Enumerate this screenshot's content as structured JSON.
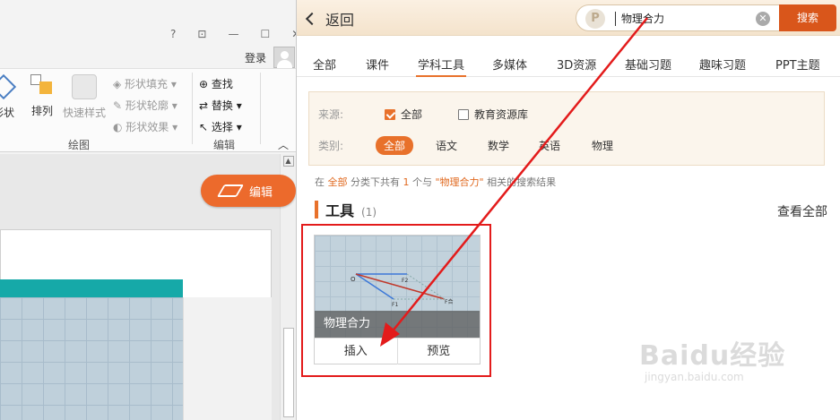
{
  "left_app": {
    "window_controls": [
      "?",
      "⊡",
      "—",
      "☐",
      "✕"
    ],
    "login": "登录",
    "ribbon": {
      "shape_label": "形状",
      "arrange_label": "排列",
      "quick_style_label": "快速样式",
      "shape_fill": "形状填充",
      "shape_outline": "形状轮廓",
      "shape_effect": "形状效果",
      "find": "查找",
      "replace": "替换",
      "select": "选择",
      "group_draw": "绘图",
      "group_edit": "编辑"
    },
    "edit_button": "编辑"
  },
  "panel": {
    "back_label": "返回",
    "search": {
      "value": "物理合力",
      "button": "搜索",
      "logo_letter": "P"
    },
    "tabs": [
      {
        "label": "全部"
      },
      {
        "label": "课件"
      },
      {
        "label": "学科工具",
        "active": true
      },
      {
        "label": "多媒体"
      },
      {
        "label": "3D资源"
      },
      {
        "label": "基础习题"
      },
      {
        "label": "趣味习题"
      },
      {
        "label": "PPT主题"
      }
    ],
    "filters": {
      "source_label": "来源:",
      "source_all": "全部",
      "source_library": "教育资源库",
      "category_label": "类别:",
      "categories": [
        "全部",
        "语文",
        "数学",
        "英语",
        "物理"
      ]
    },
    "summary": {
      "p1": "在",
      "scope": "全部",
      "p2": "分类下共有",
      "count": "1",
      "p3": "个与",
      "query": "\"物理合力\"",
      "p4": "相关的搜索结果"
    },
    "section": {
      "title": "工具",
      "count": "(1)",
      "view_all": "查看全部"
    },
    "card": {
      "name": "物理合力",
      "insert": "插入",
      "preview": "预览",
      "diagram_labels": {
        "origin": "O",
        "f1": "F1",
        "f2": "F2",
        "fr": "F合"
      }
    },
    "colors": {
      "accent": "#e8712b",
      "annotation": "#e31b1b"
    }
  },
  "watermark": {
    "main": "Baidu经验",
    "sub": "jingyan.baidu.com"
  }
}
